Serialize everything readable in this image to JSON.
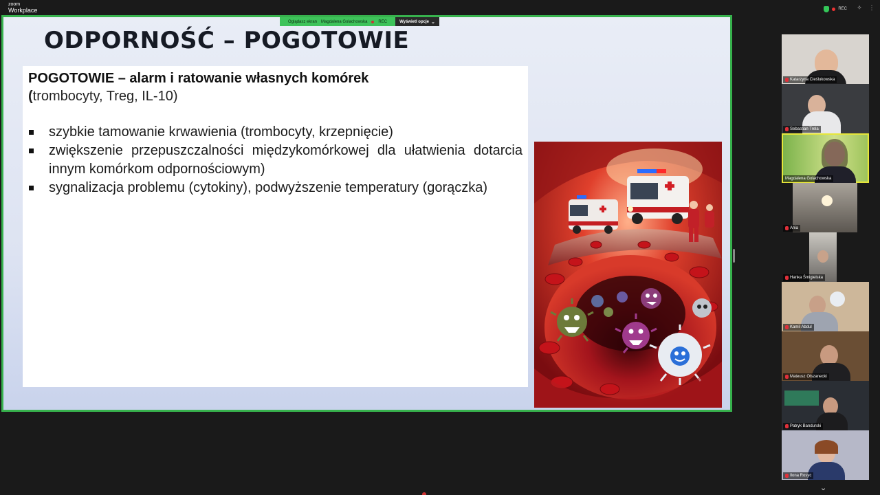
{
  "app": {
    "logo_line1": "zoom",
    "logo_line2": "Workplace",
    "rec_label": "REC"
  },
  "share_banner": {
    "viewing_label": "Oglądasz ekran",
    "presenter": "Magdalena Golachowska",
    "rec_label": "REC",
    "options_label": "Wyświetl opcje"
  },
  "slide": {
    "title": "ODPORNOŚĆ – POGOTOWIE",
    "heading": "POGOTOWIE – alarm i ratowanie własnych komórek",
    "subheading_bracket": "(",
    "subheading_rest": "trombocyty, Treg, IL-10)",
    "bullets": [
      "szybkie tamowanie krwawienia (trombocyty, krzepnięcie)",
      "zwiększenie przepuszczalności międzykomórkowej dla ułatwienia dotarcia innym komórkom odpornościowym)",
      "sygnalizacja problemu (cytokiny), podwyższenie temperatury (gorączka)"
    ]
  },
  "participants": [
    {
      "name": "Katarzyna Cieślukowska",
      "muted": true
    },
    {
      "name": "Sebastian Trela",
      "muted": true
    },
    {
      "name": "Magdalena Golachowska",
      "muted": false,
      "active": true
    },
    {
      "name": "Ania",
      "muted": true
    },
    {
      "name": "Hanka Śmigielska",
      "muted": true
    },
    {
      "name": "Kamil Abdul",
      "muted": true
    },
    {
      "name": "Mateusz Olszanecki",
      "muted": true
    },
    {
      "name": "Patryk Bandurski",
      "muted": true
    },
    {
      "name": "Ilona Rosyc",
      "muted": true
    }
  ],
  "colors": {
    "share_border": "#37b24d",
    "banner_green": "#3ec35a",
    "active_speaker": "#e6e63a"
  }
}
